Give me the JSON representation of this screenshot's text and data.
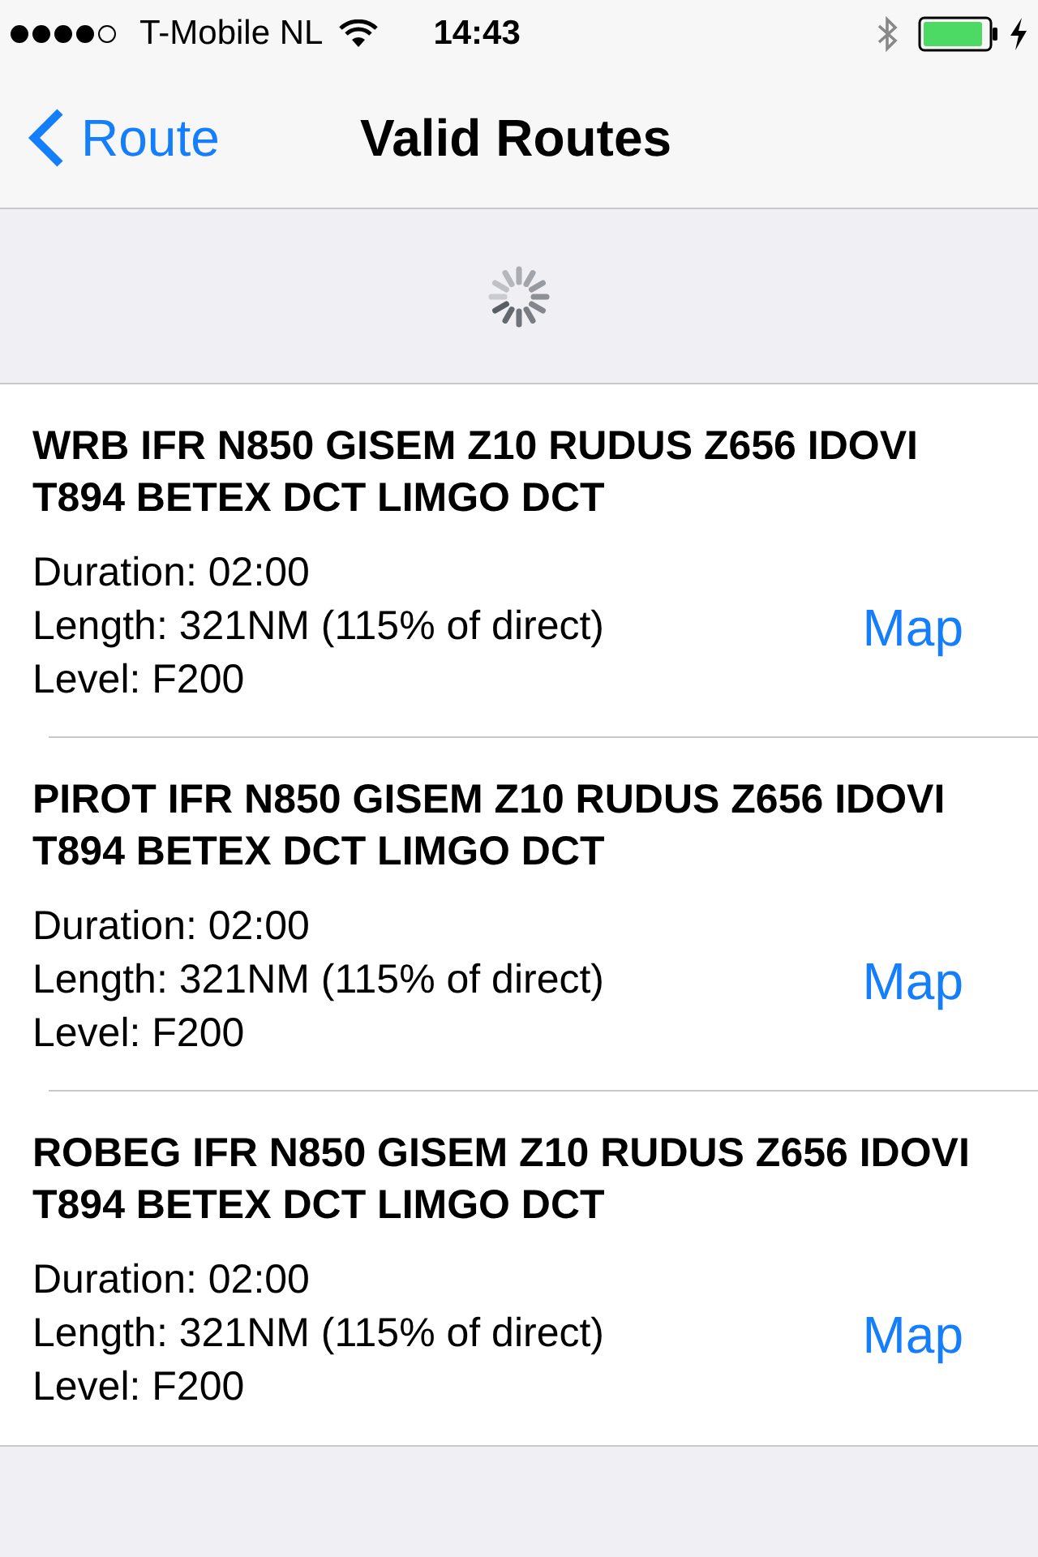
{
  "status_bar": {
    "carrier": "T-Mobile NL",
    "time": "14:43"
  },
  "nav": {
    "back_label": "Route",
    "title": "Valid Routes"
  },
  "routes": [
    {
      "title": "WRB IFR N850 GISEM Z10 RUDUS Z656 IDOVI T894 BETEX DCT LIMGO DCT",
      "duration": "Duration: 02:00",
      "length": "Length: 321NM (115% of direct)",
      "flight_level": "Level: F200",
      "map_label": "Map"
    },
    {
      "title": "PIROT IFR N850 GISEM Z10 RUDUS Z656 IDOVI T894 BETEX DCT LIMGO DCT",
      "duration": "Duration: 02:00",
      "length": "Length: 321NM (115% of direct)",
      "flight_level": "Level: F200",
      "map_label": "Map"
    },
    {
      "title": "ROBEG IFR N850 GISEM Z10 RUDUS Z656 IDOVI T894 BETEX DCT LIMGO DCT",
      "duration": "Duration: 02:00",
      "length": "Length: 321NM (115% of direct)",
      "flight_level": "Level: F200",
      "map_label": "Map"
    }
  ]
}
